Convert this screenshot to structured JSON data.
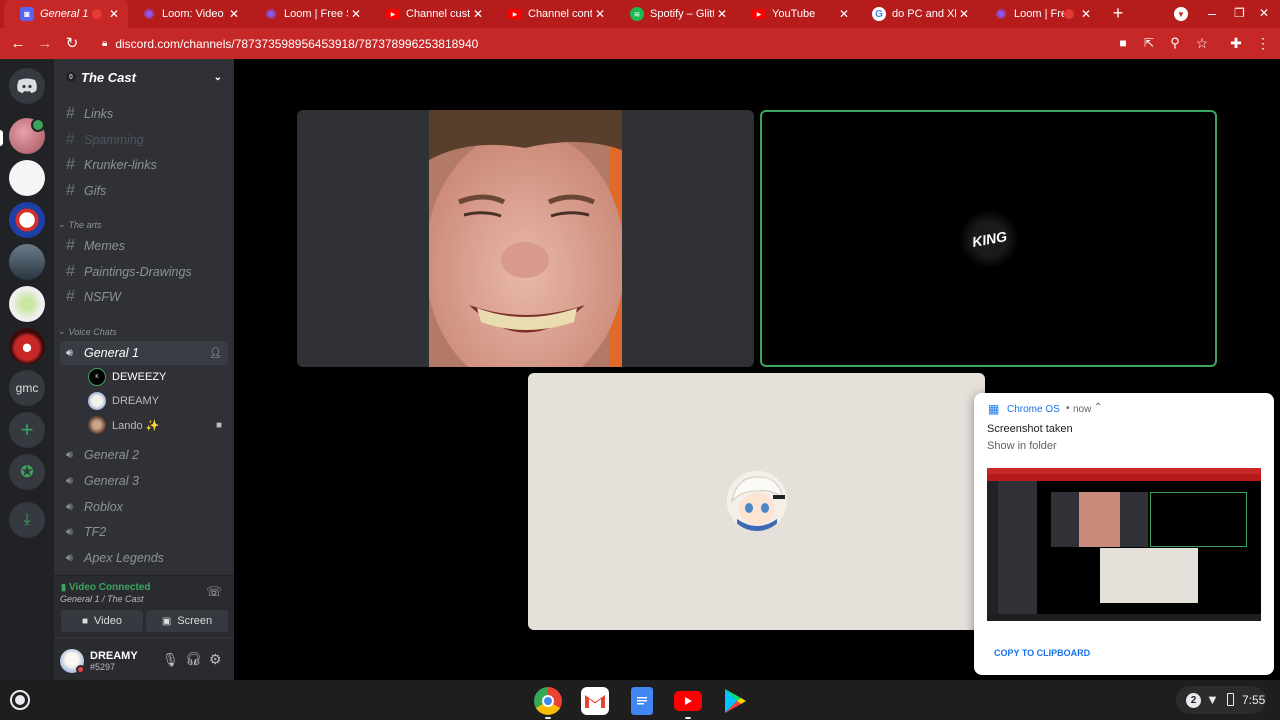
{
  "browser": {
    "tabs": [
      {
        "title": "General 1",
        "favicon": "discord-icon",
        "color": "#5865f2"
      },
      {
        "title": "Loom: Video M",
        "favicon": "loom-icon",
        "color": "#8a5cf6"
      },
      {
        "title": "Loom | Free Sc",
        "favicon": "loom-icon",
        "color": "#8a5cf6"
      },
      {
        "title": "Channel custor",
        "favicon": "youtube-icon",
        "color": "#ff0000"
      },
      {
        "title": "Channel conter",
        "favicon": "youtube-icon",
        "color": "#ff0000"
      },
      {
        "title": "Spotify – Glitte",
        "favicon": "spotify-icon",
        "color": "#1db954"
      },
      {
        "title": "YouTube",
        "favicon": "youtube-icon",
        "color": "#ff0000"
      },
      {
        "title": "do PC and Xbo",
        "favicon": "google-icon",
        "color": "#ffffff"
      },
      {
        "title": "Loom | Fre",
        "favicon": "loom-icon",
        "color": "#8a5cf6"
      }
    ],
    "url": "discord.com/channels/787373598956453918/787378996253818940"
  },
  "discord": {
    "server_name": "The Cast",
    "channels_top": [
      {
        "name": "Links",
        "muted": false
      },
      {
        "name": "Spamming",
        "muted": true
      },
      {
        "name": "Krunker-links",
        "muted": false
      },
      {
        "name": "Gifs",
        "muted": false
      }
    ],
    "category_arts": "The arts",
    "channels_arts": [
      {
        "name": "Memes"
      },
      {
        "name": "Paintings-Drawings"
      },
      {
        "name": "NSFW"
      }
    ],
    "category_voice": "Voice Chats",
    "voice_channels": [
      {
        "name": "General 1"
      },
      {
        "name": "General 2"
      },
      {
        "name": "General 3"
      },
      {
        "name": "Roblox"
      },
      {
        "name": "TF2"
      },
      {
        "name": "Apex Legends"
      }
    ],
    "voice_users": [
      {
        "name": "DEWEEZY"
      },
      {
        "name": "DREAMY"
      },
      {
        "name": "Lando ✨"
      }
    ],
    "server_text_icon": "gmc",
    "connection": {
      "status": "Video Connected",
      "location": "General 1 / The Cast",
      "video_label": "Video",
      "screen_label": "Screen"
    },
    "user": {
      "name": "DREAMY",
      "tag": "#5297"
    },
    "video_tile_logo": "KING"
  },
  "notification": {
    "source": "Chrome OS",
    "time": "now",
    "title": "Screenshot taken",
    "subtitle": "Show in folder",
    "action": "COPY TO CLIPBOARD"
  },
  "shelf": {
    "badge_count": "2",
    "time": "7:55"
  },
  "colors": {
    "accent_red": "#c62828",
    "discord_green": "#3ba55d",
    "link_blue": "#1a73e8"
  }
}
